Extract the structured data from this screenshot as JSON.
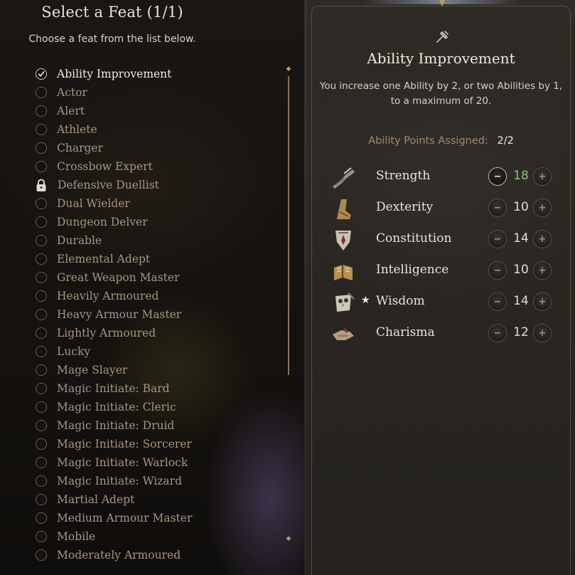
{
  "feat_selection": {
    "title": "Select a Feat (1/1)",
    "subtitle": "Choose a feat from the list below.",
    "feats": [
      {
        "label": "Ability Improvement",
        "state": "selected"
      },
      {
        "label": "Actor",
        "state": "unselected"
      },
      {
        "label": "Alert",
        "state": "unselected"
      },
      {
        "label": "Athlete",
        "state": "unselected"
      },
      {
        "label": "Charger",
        "state": "unselected"
      },
      {
        "label": "Crossbow Expert",
        "state": "unselected"
      },
      {
        "label": "Defensive Duellist",
        "state": "locked"
      },
      {
        "label": "Dual Wielder",
        "state": "unselected"
      },
      {
        "label": "Dungeon Delver",
        "state": "unselected"
      },
      {
        "label": "Durable",
        "state": "unselected"
      },
      {
        "label": "Elemental Adept",
        "state": "unselected"
      },
      {
        "label": "Great Weapon Master",
        "state": "unselected"
      },
      {
        "label": "Heavily Armoured",
        "state": "unselected"
      },
      {
        "label": "Heavy Armour Master",
        "state": "unselected"
      },
      {
        "label": "Lightly Armoured",
        "state": "unselected"
      },
      {
        "label": "Lucky",
        "state": "unselected"
      },
      {
        "label": "Mage Slayer",
        "state": "unselected"
      },
      {
        "label": "Magic Initiate: Bard",
        "state": "unselected"
      },
      {
        "label": "Magic Initiate: Cleric",
        "state": "unselected"
      },
      {
        "label": "Magic Initiate: Druid",
        "state": "unselected"
      },
      {
        "label": "Magic Initiate: Sorcerer",
        "state": "unselected"
      },
      {
        "label": "Magic Initiate: Warlock",
        "state": "unselected"
      },
      {
        "label": "Magic Initiate: Wizard",
        "state": "unselected"
      },
      {
        "label": "Martial Adept",
        "state": "unselected"
      },
      {
        "label": "Medium Armour Master",
        "state": "unselected"
      },
      {
        "label": "Mobile",
        "state": "unselected"
      },
      {
        "label": "Moderately Armoured",
        "state": "unselected"
      }
    ]
  },
  "feat_detail": {
    "icon": "hammer-icon",
    "title": "Ability Improvement",
    "description": "You increase one Ability by 2, or two Abilities by 1, to a maximum of 20.",
    "points_label": "Ability Points Assigned:",
    "points_value": "2/2",
    "abilities": [
      {
        "name": "Strength",
        "value": "18",
        "icon": "strength-arm-icon",
        "starred": false,
        "boosted": true
      },
      {
        "name": "Dexterity",
        "value": "10",
        "icon": "dexterity-boot-icon",
        "starred": false,
        "boosted": false
      },
      {
        "name": "Constitution",
        "value": "14",
        "icon": "constitution-shield-icon",
        "starred": false,
        "boosted": false
      },
      {
        "name": "Intelligence",
        "value": "10",
        "icon": "intelligence-book-icon",
        "starred": false,
        "boosted": false
      },
      {
        "name": "Wisdom",
        "value": "14",
        "icon": "wisdom-owl-icon",
        "starred": true,
        "boosted": false
      },
      {
        "name": "Charisma",
        "value": "12",
        "icon": "charisma-hand-icon",
        "starred": false,
        "boosted": false
      }
    ],
    "minus_symbol": "−",
    "plus_symbol": "+",
    "star_symbol": "★"
  },
  "colors": {
    "boosted_value": "#8fc47a",
    "feat_text": "#a89580",
    "selected_text": "#f1ebe0"
  }
}
